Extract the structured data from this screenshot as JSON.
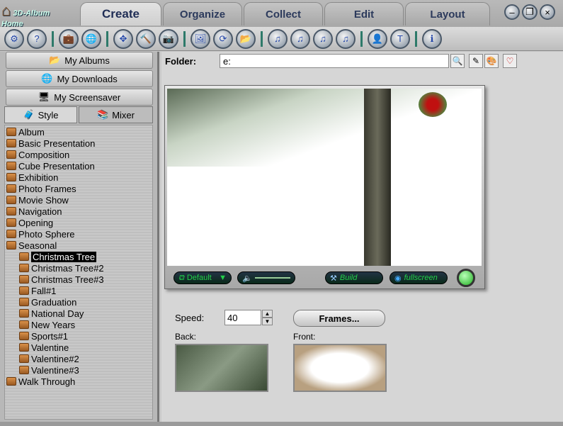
{
  "app": {
    "logo": "3D-Album Home",
    "tabs": [
      "Create",
      "Organize",
      "Collect",
      "Edit",
      "Layout"
    ],
    "active_tab": "Create"
  },
  "toolbar": {
    "icons": [
      "settings-icon",
      "help-icon",
      "briefcase-icon",
      "globe-icon",
      "move-icon",
      "hammer-icon",
      "camera-icon",
      "photos-icon",
      "refresh-icon",
      "folder-icon",
      "music-icon",
      "music-add-icon",
      "music-disc-icon",
      "music-remove-icon",
      "user-icon",
      "text-icon",
      "info-icon"
    ],
    "glyphs": [
      "⚙",
      "?",
      "💼",
      "🌐",
      "✥",
      "🔨",
      "📷",
      "🖼",
      "⟳",
      "📂",
      "♫",
      "♫",
      "♫",
      "♫",
      "👤",
      "T",
      "ℹ"
    ]
  },
  "left": {
    "my_albums": "My Albums",
    "my_downloads": "My Downloads",
    "my_screensaver": "My Screensaver",
    "tab_style": "Style",
    "tab_mixer": "Mixer",
    "tree": [
      {
        "label": "Album",
        "level": 0
      },
      {
        "label": "Basic Presentation",
        "level": 0
      },
      {
        "label": "Composition",
        "level": 0
      },
      {
        "label": "Cube Presentation",
        "level": 0
      },
      {
        "label": "Exhibition",
        "level": 0
      },
      {
        "label": "Photo Frames",
        "level": 0
      },
      {
        "label": "Movie Show",
        "level": 0
      },
      {
        "label": "Navigation",
        "level": 0
      },
      {
        "label": "Opening",
        "level": 0
      },
      {
        "label": "Photo Sphere",
        "level": 0
      },
      {
        "label": "Seasonal",
        "level": 0
      },
      {
        "label": "Christmas Tree",
        "level": 1,
        "selected": true
      },
      {
        "label": "Christmas Tree#2",
        "level": 1
      },
      {
        "label": "Christmas Tree#3",
        "level": 1
      },
      {
        "label": "Fall#1",
        "level": 1
      },
      {
        "label": "Graduation",
        "level": 1
      },
      {
        "label": "National Day",
        "level": 1
      },
      {
        "label": "New Years",
        "level": 1
      },
      {
        "label": "Sports#1",
        "level": 1
      },
      {
        "label": "Valentine",
        "level": 1
      },
      {
        "label": "Valentine#2",
        "level": 1
      },
      {
        "label": "Valentine#3",
        "level": 1
      },
      {
        "label": "Walk Through",
        "level": 0
      }
    ]
  },
  "main": {
    "folder_label": "Folder:",
    "folder_value": "e:",
    "preview": {
      "layout": "Default",
      "build": "Build",
      "fullscreen": "fullscreen"
    },
    "speed_label": "Speed:",
    "speed_value": "40",
    "frames_button": "Frames...",
    "back_label": "Back:",
    "front_label": "Front:"
  }
}
